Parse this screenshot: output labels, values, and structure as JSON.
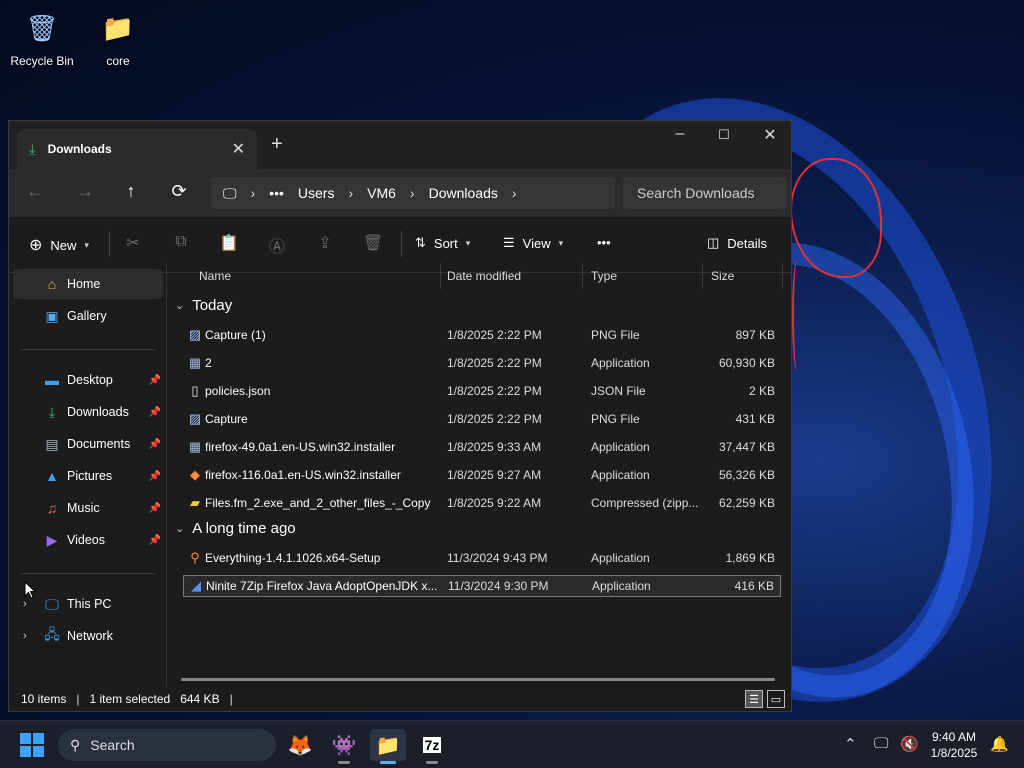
{
  "desktop": {
    "icons": [
      {
        "label": "Recycle Bin",
        "icon": "recycle-bin-icon"
      },
      {
        "label": "core",
        "icon": "folder-icon"
      }
    ]
  },
  "window": {
    "tab_title": "Downloads",
    "new_tab_icon": "plus-icon",
    "controls": {
      "minimize": "–",
      "maximize": "☐",
      "close": "✕"
    },
    "nav": {
      "back": "←",
      "forward": "→",
      "up": "↑",
      "refresh": "⟳"
    },
    "breadcrumbs": [
      "Users",
      "VM6",
      "Downloads"
    ],
    "search_placeholder": "Search Downloads",
    "toolbar": {
      "new_label": "New",
      "sort_label": "Sort",
      "view_label": "View",
      "more_label": "•••",
      "details_label": "Details"
    },
    "sidebar": {
      "top": [
        {
          "label": "Home",
          "icon": "home-icon",
          "active": true
        },
        {
          "label": "Gallery",
          "icon": "gallery-icon"
        }
      ],
      "pinned": [
        {
          "label": "Desktop",
          "icon": "desktop-icon"
        },
        {
          "label": "Downloads",
          "icon": "download-icon"
        },
        {
          "label": "Documents",
          "icon": "document-icon"
        },
        {
          "label": "Pictures",
          "icon": "pictures-icon"
        },
        {
          "label": "Music",
          "icon": "music-icon"
        },
        {
          "label": "Videos",
          "icon": "videos-icon"
        }
      ],
      "locations": [
        {
          "label": "This PC",
          "icon": "this-pc-icon"
        },
        {
          "label": "Network",
          "icon": "network-icon"
        }
      ]
    },
    "columns": [
      "Name",
      "Date modified",
      "Type",
      "Size"
    ],
    "groups": [
      {
        "label": "Today",
        "files": [
          {
            "name": "Capture (1)",
            "date": "1/8/2025 2:22 PM",
            "type": "PNG File",
            "size": "897 KB",
            "icon": "image-file-icon"
          },
          {
            "name": "2",
            "date": "1/8/2025 2:22 PM",
            "type": "Application",
            "size": "60,930 KB",
            "icon": "application-icon"
          },
          {
            "name": "policies.json",
            "date": "1/8/2025 2:22 PM",
            "type": "JSON File",
            "size": "2 KB",
            "icon": "json-file-icon"
          },
          {
            "name": "Capture",
            "date": "1/8/2025 2:22 PM",
            "type": "PNG File",
            "size": "431 KB",
            "icon": "image-file-icon"
          },
          {
            "name": "firefox-49.0a1.en-US.win32.installer",
            "date": "1/8/2025 9:33 AM",
            "type": "Application",
            "size": "37,447 KB",
            "icon": "installer-icon"
          },
          {
            "name": "firefox-116.0a1.en-US.win32.installer",
            "date": "1/8/2025 9:27 AM",
            "type": "Application",
            "size": "56,326 KB",
            "icon": "firefox-installer-icon"
          },
          {
            "name": "Files.fm_2.exe_and_2_other_files_-_Copy",
            "date": "1/8/2025 9:22 AM",
            "type": "Compressed (zipp...",
            "size": "62,259 KB",
            "icon": "zip-folder-icon"
          }
        ]
      },
      {
        "label": "A long time ago",
        "files": [
          {
            "name": "Everything-1.4.1.1026.x64-Setup",
            "date": "11/3/2024 9:43 PM",
            "type": "Application",
            "size": "1,869 KB",
            "icon": "everything-icon"
          },
          {
            "name": "Ninite 7Zip Firefox Java AdoptOpenJDK x...",
            "date": "11/3/2024 9:30 PM",
            "type": "Application",
            "size": "416 KB",
            "icon": "ninite-icon",
            "selected": true
          }
        ]
      }
    ],
    "status": {
      "items": "10 items",
      "selected": "1 item selected",
      "size": "644 KB"
    }
  },
  "taskbar": {
    "search_label": "Search",
    "apps": [
      "firefox-icon",
      "media-app-icon",
      "file-explorer-icon",
      "7zip-icon"
    ],
    "app_glyphs": [
      "🦊",
      "👾",
      "📁",
      "7z"
    ],
    "time": "9:40 AM",
    "date": "1/8/2025"
  }
}
